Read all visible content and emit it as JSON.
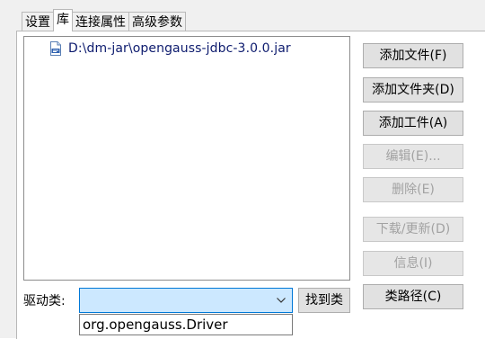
{
  "tabs": [
    {
      "label": "设置",
      "active": false
    },
    {
      "label": "库",
      "active": true
    },
    {
      "label": "连接属性",
      "active": false
    },
    {
      "label": "高级参数",
      "active": false
    }
  ],
  "library": {
    "items": [
      {
        "icon": "jar-file-icon",
        "path": "D:\\dm-jar\\opengauss-jdbc-3.0.0.jar"
      }
    ]
  },
  "buttons": {
    "add_file": "添加文件(F)",
    "add_folder": "添加文件夹(D)",
    "add_artifact": "添加工件(A)",
    "edit": "编辑(E)...",
    "delete": "删除(E)",
    "download_update": "下载/更新(D)",
    "info": "信息(I)",
    "classpath": "类路径(C)"
  },
  "driver": {
    "label": "驱动类:",
    "value": "",
    "find_button": "找到类",
    "options": [
      "org.opengauss.Driver"
    ]
  },
  "colors": {
    "accent": "#0078d7",
    "combo_bg": "#cce8ff",
    "disabled_text": "#a2a2a2"
  }
}
